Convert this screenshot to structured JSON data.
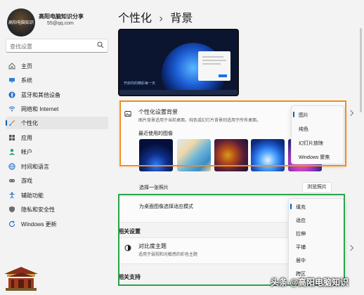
{
  "user": {
    "avatar_text": "高阳电脑知识",
    "name": "高阳电脑知识分享",
    "email": "55@qq.com"
  },
  "search": {
    "placeholder": "查找设置"
  },
  "sidebar": {
    "items": [
      {
        "label": "主页",
        "icon": "home-icon"
      },
      {
        "label": "系统",
        "icon": "system-icon"
      },
      {
        "label": "蓝牙和其他设备",
        "icon": "bluetooth-icon"
      },
      {
        "label": "网络和 Internet",
        "icon": "wifi-icon"
      },
      {
        "label": "个性化",
        "icon": "brush-icon",
        "active": true
      },
      {
        "label": "应用",
        "icon": "apps-icon"
      },
      {
        "label": "帐户",
        "icon": "account-icon"
      },
      {
        "label": "时间和语言",
        "icon": "globe-icon"
      },
      {
        "label": "游戏",
        "icon": "gamepad-icon"
      },
      {
        "label": "辅助功能",
        "icon": "accessibility-icon"
      },
      {
        "label": "隐私和安全性",
        "icon": "shield-icon"
      },
      {
        "label": "Windows 更新",
        "icon": "update-icon"
      }
    ]
  },
  "breadcrumb": {
    "parent": "个性化",
    "separator": "›",
    "current": "背景"
  },
  "preview": {
    "taskbar_text": "开启你的精彩每一天"
  },
  "background_card": {
    "title": "个性化设置背景",
    "subtitle": "图片背景适用于当前桌面。纯色或幻灯片背景则适用于所有桌面。",
    "recent_label": "最近使用的图像"
  },
  "background_dropdown": {
    "options": [
      "图片",
      "纯色",
      "幻灯片放映",
      "Windows 聚焦"
    ],
    "selected": "图片"
  },
  "choose_photo": {
    "label": "选择一张照片",
    "button": "浏览照片"
  },
  "fit_card": {
    "title": "为桌面图像选择适应模式"
  },
  "fit_dropdown": {
    "options": [
      "填充",
      "适应",
      "拉伸",
      "平铺",
      "居中",
      "跨区"
    ],
    "selected": "填充"
  },
  "related": {
    "section_label": "相关设置",
    "contrast_title": "对比度主题",
    "contrast_subtitle": "适用于弱视和光敏感的彩色主题"
  },
  "support": {
    "section_label": "相关支持"
  },
  "watermark": "头条 @高阳电脑知识",
  "colors": {
    "accent": "#005fb8",
    "orange_highlight": "#f28c1b",
    "green_highlight": "#2aa34a"
  }
}
